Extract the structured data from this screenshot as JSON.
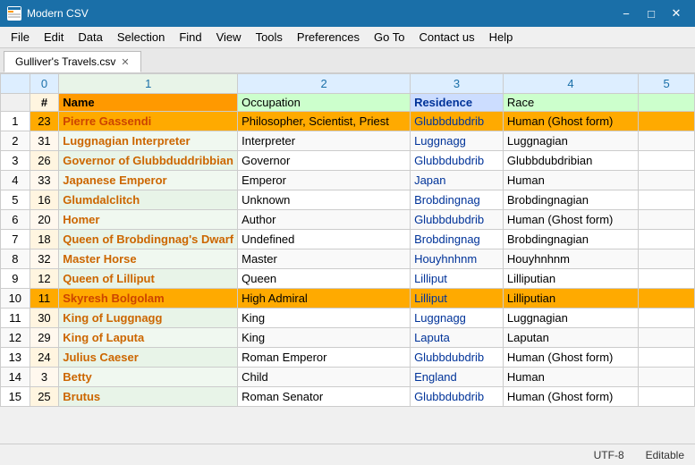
{
  "titleBar": {
    "icon": "csv-icon",
    "title": "Modern CSV",
    "minimizeLabel": "−",
    "maximizeLabel": "□",
    "closeLabel": "✕"
  },
  "menuBar": {
    "items": [
      {
        "id": "file",
        "label": "File"
      },
      {
        "id": "edit",
        "label": "Edit"
      },
      {
        "id": "data",
        "label": "Data"
      },
      {
        "id": "selection",
        "label": "Selection"
      },
      {
        "id": "find",
        "label": "Find"
      },
      {
        "id": "view",
        "label": "View"
      },
      {
        "id": "tools",
        "label": "Tools"
      },
      {
        "id": "preferences",
        "label": "Preferences"
      },
      {
        "id": "goto",
        "label": "Go To"
      },
      {
        "id": "contactus",
        "label": "Contact us"
      },
      {
        "id": "help",
        "label": "Help"
      }
    ]
  },
  "tabBar": {
    "tabs": [
      {
        "id": "tab1",
        "label": "Gulliver's Travels.csv",
        "active": true
      }
    ]
  },
  "sheet": {
    "columns": [
      {
        "id": 0,
        "label": "0",
        "class": "w0"
      },
      {
        "id": 1,
        "label": "1",
        "class": "w1",
        "selected": true
      },
      {
        "id": 2,
        "label": "2",
        "class": "w2"
      },
      {
        "id": 3,
        "label": "3",
        "class": "w3"
      },
      {
        "id": 4,
        "label": "4",
        "class": "w4"
      },
      {
        "id": 5,
        "label": "5",
        "class": "w5"
      }
    ],
    "headerRow": {
      "rowNum": "",
      "cells": [
        "#",
        "Name",
        "Occupation",
        "Residence",
        "Race",
        ""
      ]
    },
    "rows": [
      {
        "rowNum": 1,
        "cells": [
          "23",
          "Pierre Gassendi",
          "Philosopher, Scientist, Priest",
          "Glubbdubdrib",
          "Human (Ghost form)",
          ""
        ],
        "highlight": "orange"
      },
      {
        "rowNum": 2,
        "cells": [
          "31",
          "Luggnagian Interpreter",
          "Interpreter",
          "Luggnagg",
          "Luggnagian",
          ""
        ],
        "highlight": ""
      },
      {
        "rowNum": 3,
        "cells": [
          "26",
          "Governor of Glubbduddribbian",
          "Governor",
          "Glubbdubdrib",
          "Glubbdubdribian",
          ""
        ],
        "highlight": ""
      },
      {
        "rowNum": 4,
        "cells": [
          "33",
          "Japanese Emperor",
          "Emperor",
          "Japan",
          "Human",
          ""
        ],
        "highlight": ""
      },
      {
        "rowNum": 5,
        "cells": [
          "16",
          "Glumdalclitch",
          "Unknown",
          "Brobdingnag",
          "Brobdingnagian",
          ""
        ],
        "highlight": ""
      },
      {
        "rowNum": 6,
        "cells": [
          "20",
          "Homer",
          "Author",
          "Glubbdubdrib",
          "Human (Ghost form)",
          ""
        ],
        "highlight": ""
      },
      {
        "rowNum": 7,
        "cells": [
          "18",
          "Queen of Brobdingnag's Dwarf",
          "Undefined",
          "Brobdingnag",
          "Brobdingnagian",
          ""
        ],
        "highlight": ""
      },
      {
        "rowNum": 8,
        "cells": [
          "32",
          "Master Horse",
          "Master",
          "Houyhnhnm",
          "Houyhnhnm",
          ""
        ],
        "highlight": ""
      },
      {
        "rowNum": 9,
        "cells": [
          "12",
          "Queen of Lilliput",
          "Queen",
          "Lilliput",
          "Lilliputian",
          ""
        ],
        "highlight": ""
      },
      {
        "rowNum": 10,
        "cells": [
          "11",
          "Skyresh Bolgolam",
          "High Admiral",
          "Lilliput",
          "Lilliputian",
          ""
        ],
        "highlight": "orange"
      },
      {
        "rowNum": 11,
        "cells": [
          "30",
          "King of Luggnagg",
          "King",
          "Luggnagg",
          "Luggnagian",
          ""
        ],
        "highlight": ""
      },
      {
        "rowNum": 12,
        "cells": [
          "29",
          "King of Laputa",
          "King",
          "Laputa",
          "Laputan",
          ""
        ],
        "highlight": ""
      },
      {
        "rowNum": 13,
        "cells": [
          "24",
          "Julius Caeser",
          "Roman Emperor",
          "Glubbdubdrib",
          "Human (Ghost form)",
          ""
        ],
        "highlight": ""
      },
      {
        "rowNum": 14,
        "cells": [
          "3",
          "Betty",
          "Child",
          "England",
          "Human",
          ""
        ],
        "highlight": ""
      },
      {
        "rowNum": 15,
        "cells": [
          "25",
          "Brutus",
          "Roman Senator",
          "Glubbdubdrib",
          "Human (Ghost form)",
          ""
        ],
        "highlight": ""
      }
    ]
  },
  "statusBar": {
    "encoding": "UTF-8",
    "mode": "Editable"
  },
  "colors": {
    "titleBarBg": "#1a6fa8",
    "selectedColBg": "#e8f4e8",
    "colHeaderBg": "#ddeeff",
    "orangeRowBg": "#ffaa00",
    "nameCellBg": "#ff9900",
    "occHeaderBg": "#ccffcc",
    "resHeaderBg": "#ccddff",
    "raceHeaderBg": "#ccffcc"
  }
}
